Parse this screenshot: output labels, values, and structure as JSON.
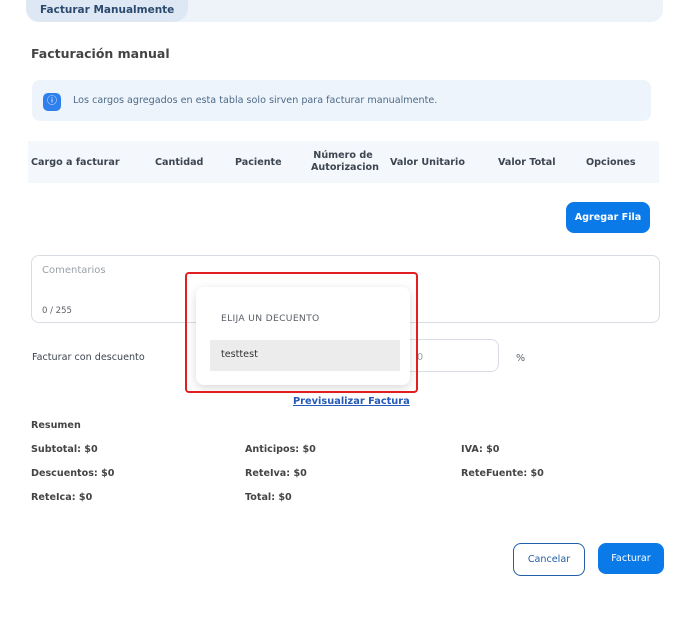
{
  "tabs": {
    "active_label": "Facturar Manualmente"
  },
  "page": {
    "title": "Facturación manual"
  },
  "info": {
    "icon": "info-icon",
    "text": "Los cargos agregados en esta tabla solo sirven para facturar manualmente."
  },
  "table": {
    "headers": [
      "Cargo a facturar",
      "Cantidad",
      "Paciente",
      "Número de Autorizacion",
      "Valor Unitario",
      "Valor Total",
      "Opciones"
    ],
    "header_auth_line1": "Número de",
    "header_auth_line2": "Autorizacion"
  },
  "actions": {
    "add_row": "Agregar Fila"
  },
  "comments": {
    "placeholder": "Comentarios",
    "counter": "0 / 255"
  },
  "discount": {
    "label": "Facturar con descuento",
    "percent_value": "0",
    "percent_sign": "%",
    "dropdown_header": "ELIJA UN DECUENTO",
    "options": [
      "testtest"
    ]
  },
  "preview_link": "Previsualizar Factura",
  "summary": {
    "heading": "Resumen",
    "subtotal": "Subtotal: $0",
    "anticipos": "Anticipos: $0",
    "iva": "IVA: $0",
    "descuentos": "Descuentos: $0",
    "reteiva": "ReteIva: $0",
    "retefuente": "ReteFuente: $0",
    "reteica": "ReteIca: $0",
    "total": "Total: $0"
  },
  "footer": {
    "cancel": "Cancelar",
    "submit": "Facturar"
  },
  "colors": {
    "primary": "#0a7ae8",
    "highlight": "#e02020",
    "outline": "#1f5fa8"
  }
}
